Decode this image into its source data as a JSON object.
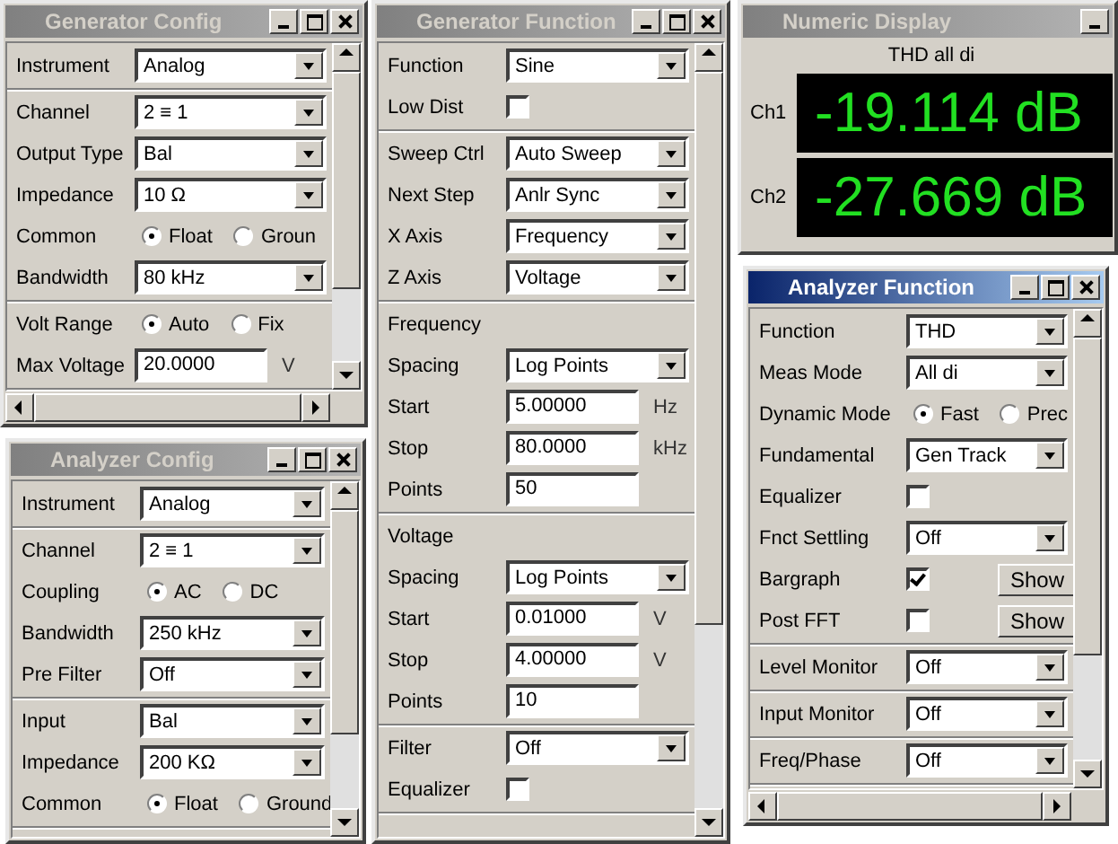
{
  "windows": [
    {
      "kind": "form",
      "title": "Generator Config",
      "active": false,
      "groups": [
        [
          {
            "kind": "select",
            "label": "Instrument",
            "value": "Analog"
          }
        ],
        [
          {
            "kind": "select",
            "label": "Channel",
            "value": "2 ≡ 1"
          },
          {
            "kind": "select",
            "label": "Output Type",
            "value": "Bal"
          },
          {
            "kind": "select",
            "label": "Impedance",
            "value": "10 Ω"
          },
          {
            "kind": "radio",
            "label": "Common",
            "options": [
              {
                "label": "Float",
                "selected": true
              },
              {
                "label": "Groun",
                "selected": false
              }
            ]
          },
          {
            "kind": "select",
            "label": "Bandwidth",
            "value": "80 kHz"
          }
        ],
        [
          {
            "kind": "radio",
            "label": "Volt Range",
            "options": [
              {
                "label": "Auto",
                "selected": true
              },
              {
                "label": "Fix",
                "selected": false
              }
            ]
          },
          {
            "kind": "input",
            "label": "Max Voltage",
            "value": "20.0000",
            "unit": "V"
          }
        ]
      ]
    },
    {
      "kind": "form",
      "title": "Generator Function",
      "active": false,
      "groups": [
        [
          {
            "kind": "select",
            "label": "Function",
            "value": "Sine"
          },
          {
            "kind": "checkbox",
            "label": "Low Dist",
            "checked": false
          }
        ],
        [
          {
            "kind": "select",
            "label": "Sweep Ctrl",
            "value": "Auto Sweep"
          },
          {
            "kind": "select",
            "label": "Next Step",
            "value": "Anlr Sync"
          },
          {
            "kind": "select",
            "label": "X Axis",
            "value": "Frequency"
          },
          {
            "kind": "select",
            "label": "Z Axis",
            "value": "Voltage"
          }
        ],
        [
          {
            "kind": "heading",
            "label": "Frequency"
          },
          {
            "kind": "select",
            "label": "Spacing",
            "value": "Log Points"
          },
          {
            "kind": "input",
            "label": "Start",
            "value": "5.00000",
            "unit": "Hz"
          },
          {
            "kind": "input",
            "label": "Stop",
            "value": "80.0000",
            "unit": "kHz"
          },
          {
            "kind": "input",
            "label": "Points",
            "value": "50"
          }
        ],
        [
          {
            "kind": "heading",
            "label": "Voltage"
          },
          {
            "kind": "select",
            "label": "Spacing",
            "value": "Log Points"
          },
          {
            "kind": "input",
            "label": "Start",
            "value": "0.01000",
            "unit": "V"
          },
          {
            "kind": "input",
            "label": "Stop",
            "value": "4.00000",
            "unit": "V"
          },
          {
            "kind": "input",
            "label": "Points",
            "value": "10"
          }
        ],
        [
          {
            "kind": "select",
            "label": "Filter",
            "value": "Off"
          },
          {
            "kind": "checkbox",
            "label": "Equalizer",
            "checked": false
          }
        ]
      ]
    },
    {
      "kind": "numeric",
      "title": "Numeric Display",
      "active": false,
      "heading": "THD all di",
      "channels": [
        {
          "label": "Ch1",
          "value": "-19.114 dB"
        },
        {
          "label": "Ch2",
          "value": "-27.669 dB"
        }
      ]
    },
    {
      "kind": "form",
      "title": "Analyzer Config",
      "active": false,
      "groups": [
        [
          {
            "kind": "select",
            "label": "Instrument",
            "value": "Analog"
          }
        ],
        [
          {
            "kind": "select",
            "label": "Channel",
            "value": "2 ≡ 1"
          },
          {
            "kind": "radio",
            "label": "Coupling",
            "options": [
              {
                "label": "AC",
                "selected": true
              },
              {
                "label": "DC",
                "selected": false
              }
            ]
          },
          {
            "kind": "select",
            "label": "Bandwidth",
            "value": "250 kHz"
          },
          {
            "kind": "select",
            "label": "Pre Filter",
            "value": "Off"
          }
        ],
        [
          {
            "kind": "select",
            "label": "Input",
            "value": "Bal"
          },
          {
            "kind": "select",
            "label": "Impedance",
            "value": "200 KΩ"
          },
          {
            "kind": "radio",
            "label": "Common",
            "options": [
              {
                "label": "Float",
                "selected": true
              },
              {
                "label": "Ground",
                "selected": false
              }
            ]
          }
        ]
      ]
    },
    {
      "kind": "form",
      "title": "Analyzer Function",
      "active": true,
      "groups": [
        [
          {
            "kind": "select",
            "label": "Function",
            "value": "THD"
          },
          {
            "kind": "select",
            "label": "Meas Mode",
            "value": "All di"
          },
          {
            "kind": "radio",
            "label": "Dynamic Mode",
            "options": [
              {
                "label": "Fast",
                "selected": true
              },
              {
                "label": "Prec",
                "selected": false
              }
            ]
          },
          {
            "kind": "select",
            "label": "Fundamental",
            "value": "Gen Track"
          },
          {
            "kind": "checkbox",
            "label": "Equalizer",
            "checked": false
          },
          {
            "kind": "select",
            "label": "Fnct Settling",
            "value": "Off"
          },
          {
            "kind": "checkbox",
            "label": "Bargraph",
            "checked": true,
            "button": "Show"
          },
          {
            "kind": "checkbox",
            "label": "Post FFT",
            "checked": false,
            "button": "Show"
          }
        ],
        [
          {
            "kind": "select",
            "label": "Level Monitor",
            "value": "Off"
          }
        ],
        [
          {
            "kind": "select",
            "label": "Input Monitor",
            "value": "Off"
          }
        ],
        [
          {
            "kind": "select",
            "label": "Freq/Phase",
            "value": "Off"
          }
        ]
      ]
    }
  ]
}
